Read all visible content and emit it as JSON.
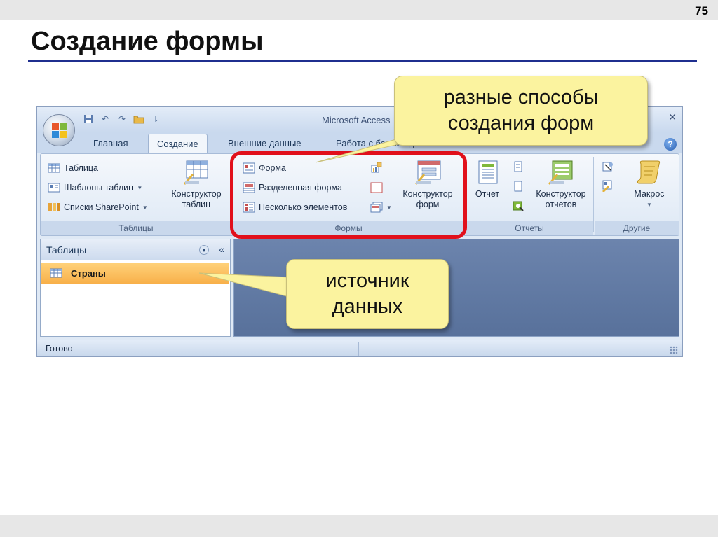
{
  "slide": {
    "number": "75",
    "title": "Создание формы"
  },
  "window": {
    "title": "Microsoft Access",
    "qat_more": "⇂"
  },
  "tabs": [
    {
      "label": "Главная"
    },
    {
      "label": "Создание"
    },
    {
      "label": "Внешние данные"
    },
    {
      "label": "Работа с базами данных"
    }
  ],
  "ribbon": {
    "tables": {
      "label": "Таблицы",
      "items": [
        "Таблица",
        "Шаблоны таблиц",
        "Списки SharePoint"
      ],
      "designer": [
        "Конструктор",
        "таблиц"
      ]
    },
    "forms": {
      "label": "Формы",
      "items": [
        "Форма",
        "Разделенная форма",
        "Несколько элементов"
      ],
      "designer": [
        "Конструктор",
        "форм"
      ]
    },
    "reports": {
      "label": "Отчеты",
      "report": "Отчет",
      "designer": [
        "Конструктор",
        "отчетов"
      ]
    },
    "other": {
      "label": "Другие",
      "macro": "Макрос"
    }
  },
  "nav_pane": {
    "title": "Таблицы",
    "item": "Страны"
  },
  "status": {
    "text": "Готово"
  },
  "callouts": {
    "methods": [
      "разные способы",
      "создания форм"
    ],
    "source": [
      "источник",
      "данных"
    ]
  },
  "colors": {
    "highlight": "#e1101b",
    "callout_bg": "#fbf39f",
    "title_rule": "#1f2f8f",
    "selected_item": "#f8b04a"
  }
}
